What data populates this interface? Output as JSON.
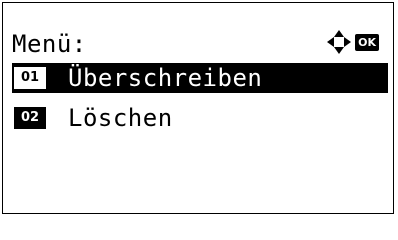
{
  "header": {
    "title": "Menü:",
    "nav_icon": "dpad-icon",
    "ok_label": "OK"
  },
  "menu": {
    "items": [
      {
        "number": "01",
        "label": "Überschreiben",
        "selected": true
      },
      {
        "number": "02",
        "label": "Löschen",
        "selected": false
      }
    ]
  }
}
